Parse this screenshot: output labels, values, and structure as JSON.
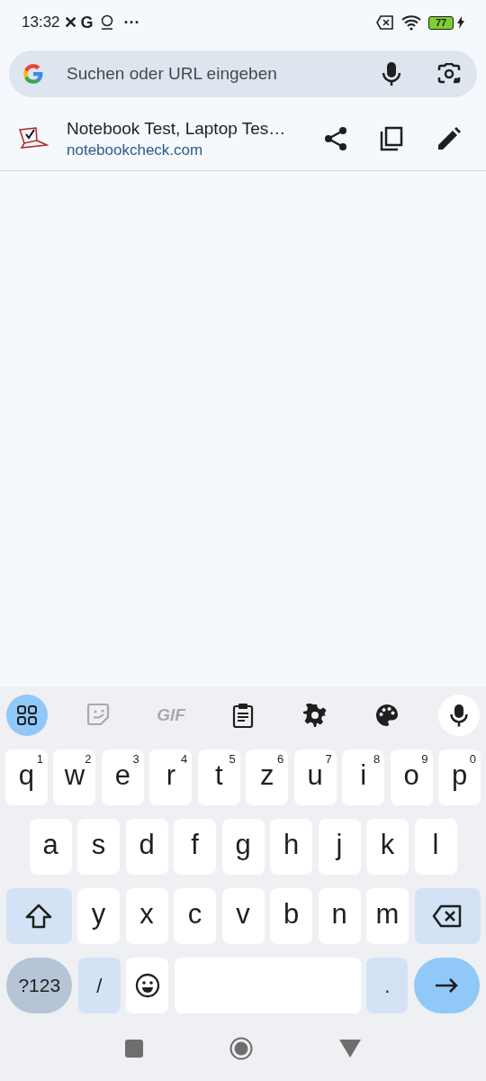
{
  "status_bar": {
    "time": "13:32",
    "notification_glyphs": [
      "✕",
      "G"
    ],
    "overflow": "···",
    "battery": "77"
  },
  "search": {
    "placeholder": "Suchen oder URL eingeben"
  },
  "suggestion": {
    "title": "Notebook Test, Laptop Tes…",
    "url": "notebookcheck.com"
  },
  "keyboard": {
    "toolbar": [
      {
        "kind": "apps",
        "selected": true,
        "disabled": false
      },
      {
        "kind": "sticker",
        "selected": false,
        "disabled": true
      },
      {
        "kind": "gif",
        "label": "GIF",
        "selected": false,
        "disabled": true
      },
      {
        "kind": "clipboard",
        "selected": false,
        "disabled": false
      },
      {
        "kind": "settings",
        "selected": false,
        "disabled": false
      },
      {
        "kind": "palette",
        "selected": false,
        "disabled": false
      },
      {
        "kind": "mic",
        "selected": false,
        "disabled": false
      }
    ],
    "rows": [
      {
        "keys": [
          {
            "kind": "letter",
            "label": "q",
            "hint": "1"
          },
          {
            "kind": "letter",
            "label": "w",
            "hint": "2"
          },
          {
            "kind": "letter",
            "label": "e",
            "hint": "3"
          },
          {
            "kind": "letter",
            "label": "r",
            "hint": "4"
          },
          {
            "kind": "letter",
            "label": "t",
            "hint": "5"
          },
          {
            "kind": "letter",
            "label": "z",
            "hint": "6"
          },
          {
            "kind": "letter",
            "label": "u",
            "hint": "7"
          },
          {
            "kind": "letter",
            "label": "i",
            "hint": "8"
          },
          {
            "kind": "letter",
            "label": "o",
            "hint": "9"
          },
          {
            "kind": "letter",
            "label": "p",
            "hint": "0"
          }
        ]
      },
      {
        "keys": [
          {
            "kind": "letter",
            "label": "a"
          },
          {
            "kind": "letter",
            "label": "s"
          },
          {
            "kind": "letter",
            "label": "d"
          },
          {
            "kind": "letter",
            "label": "f"
          },
          {
            "kind": "letter",
            "label": "g"
          },
          {
            "kind": "letter",
            "label": "h"
          },
          {
            "kind": "letter",
            "label": "j"
          },
          {
            "kind": "letter",
            "label": "k"
          },
          {
            "kind": "letter",
            "label": "l"
          }
        ]
      },
      {
        "keys": [
          {
            "kind": "shift"
          },
          {
            "kind": "letter",
            "label": "y"
          },
          {
            "kind": "letter",
            "label": "x"
          },
          {
            "kind": "letter",
            "label": "c"
          },
          {
            "kind": "letter",
            "label": "v"
          },
          {
            "kind": "letter",
            "label": "b"
          },
          {
            "kind": "letter",
            "label": "n"
          },
          {
            "kind": "letter",
            "label": "m"
          },
          {
            "kind": "backspace"
          }
        ]
      },
      {
        "keys": [
          {
            "kind": "symbols",
            "label": "?123"
          },
          {
            "kind": "slash",
            "label": "/"
          },
          {
            "kind": "emoji"
          },
          {
            "kind": "space"
          },
          {
            "kind": "period",
            "label": "."
          },
          {
            "kind": "enter"
          }
        ]
      }
    ]
  }
}
